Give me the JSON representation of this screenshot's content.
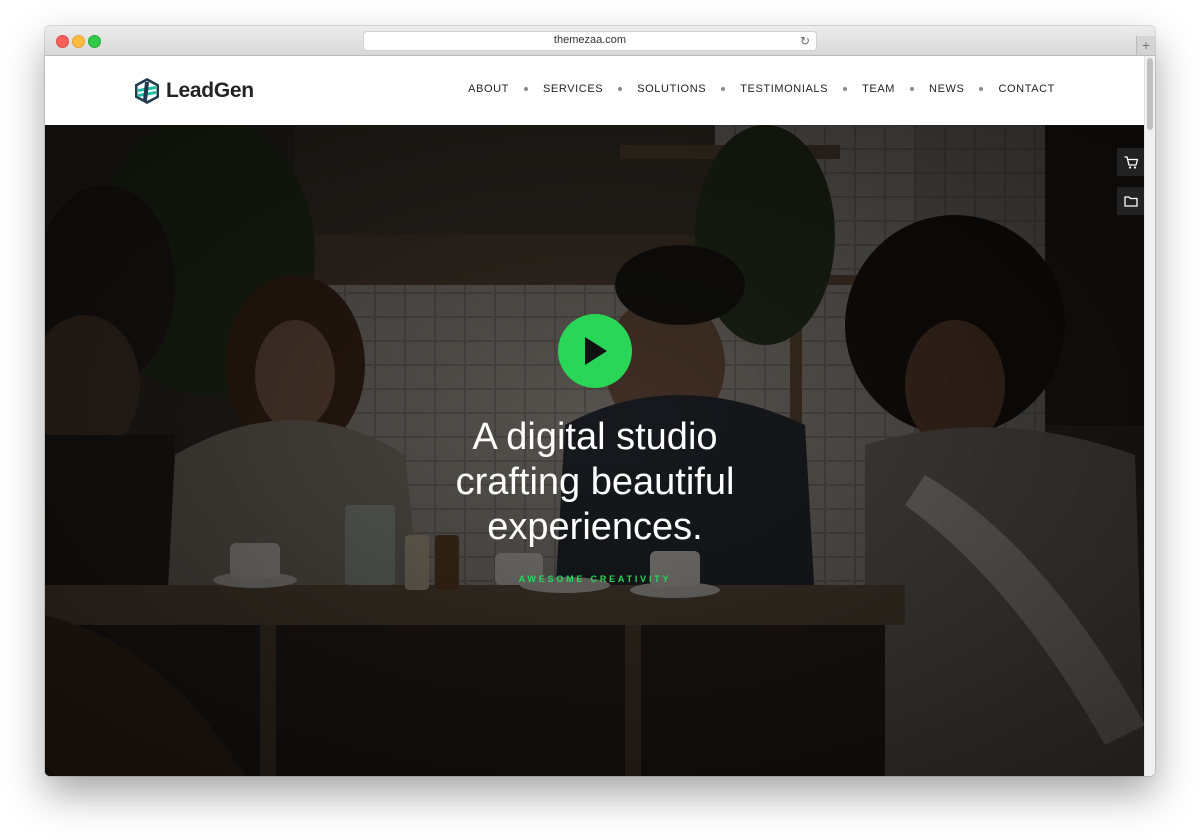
{
  "browser": {
    "url": "themezaa.com"
  },
  "site": {
    "brand": "LeadGen",
    "nav": [
      "ABOUT",
      "SERVICES",
      "SOLUTIONS",
      "TESTIMONIALS",
      "TEAM",
      "NEWS",
      "CONTACT"
    ]
  },
  "hero": {
    "headline_lines": [
      "A digital studio",
      "crafting beautiful",
      "experiences."
    ],
    "tagline": "AWESOME CREATIVITY",
    "play_icon": "play-icon",
    "side_icons": [
      "cart-icon",
      "folder-icon"
    ]
  },
  "colors": {
    "accent": "#2ad658",
    "logo_teal": "#1fbfa6",
    "logo_dark": "#1f3b4d"
  }
}
